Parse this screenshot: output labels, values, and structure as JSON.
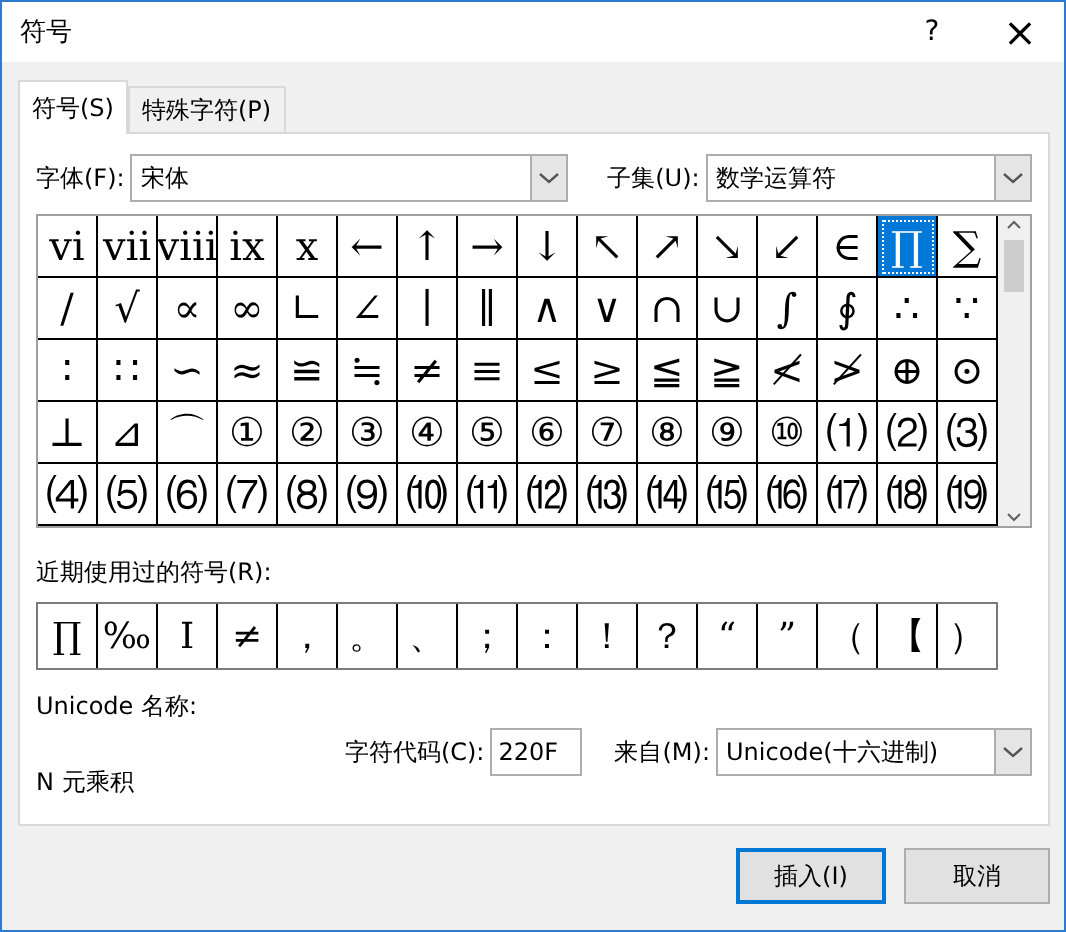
{
  "window": {
    "title": "符号",
    "help": "?",
    "close": "×"
  },
  "tabs": [
    {
      "label": "符号(S)",
      "selected": true
    },
    {
      "label": "特殊字符(P)",
      "selected": false
    }
  ],
  "font": {
    "label": "字体(F):",
    "value": "宋体"
  },
  "subset": {
    "label": "子集(U):",
    "value": "数学运算符"
  },
  "grid": [
    [
      {
        "c": "ⅵ",
        "selected": false
      },
      {
        "c": "ⅶ",
        "selected": false
      },
      {
        "c": "ⅷ",
        "selected": false
      },
      {
        "c": "ⅸ",
        "selected": false
      },
      {
        "c": "ⅹ",
        "selected": false
      },
      {
        "c": "←",
        "selected": false
      },
      {
        "c": "↑",
        "selected": false
      },
      {
        "c": "→",
        "selected": false
      },
      {
        "c": "↓",
        "selected": false
      },
      {
        "c": "↖",
        "selected": false
      },
      {
        "c": "↗",
        "selected": false
      },
      {
        "c": "↘",
        "selected": false
      },
      {
        "c": "↙",
        "selected": false
      },
      {
        "c": "∈",
        "selected": false
      },
      {
        "c": "∏",
        "selected": true
      },
      {
        "c": "∑",
        "selected": false
      }
    ],
    [
      {
        "c": "∕",
        "selected": false
      },
      {
        "c": "√",
        "selected": false
      },
      {
        "c": "∝",
        "selected": false
      },
      {
        "c": "∞",
        "selected": false
      },
      {
        "c": "∟",
        "selected": false
      },
      {
        "c": "∠",
        "selected": false
      },
      {
        "c": "∣",
        "selected": false
      },
      {
        "c": "∥",
        "selected": false
      },
      {
        "c": "∧",
        "selected": false
      },
      {
        "c": "∨",
        "selected": false
      },
      {
        "c": "∩",
        "selected": false
      },
      {
        "c": "∪",
        "selected": false
      },
      {
        "c": "∫",
        "selected": false
      },
      {
        "c": "∮",
        "selected": false
      },
      {
        "c": "∴",
        "selected": false
      },
      {
        "c": "∵",
        "selected": false
      }
    ],
    [
      {
        "c": "∶",
        "selected": false
      },
      {
        "c": "∷",
        "selected": false
      },
      {
        "c": "∽",
        "selected": false
      },
      {
        "c": "≈",
        "selected": false
      },
      {
        "c": "≌",
        "selected": false
      },
      {
        "c": "≒",
        "selected": false
      },
      {
        "c": "≠",
        "selected": false
      },
      {
        "c": "≡",
        "selected": false
      },
      {
        "c": "≤",
        "selected": false
      },
      {
        "c": "≥",
        "selected": false
      },
      {
        "c": "≦",
        "selected": false
      },
      {
        "c": "≧",
        "selected": false
      },
      {
        "c": "≮",
        "selected": false
      },
      {
        "c": "≯",
        "selected": false
      },
      {
        "c": "⊕",
        "selected": false
      },
      {
        "c": "⊙",
        "selected": false
      }
    ],
    [
      {
        "c": "⊥",
        "selected": false
      },
      {
        "c": "⊿",
        "selected": false
      },
      {
        "c": "⌒",
        "selected": false
      },
      {
        "c": "①",
        "selected": false
      },
      {
        "c": "②",
        "selected": false
      },
      {
        "c": "③",
        "selected": false
      },
      {
        "c": "④",
        "selected": false
      },
      {
        "c": "⑤",
        "selected": false
      },
      {
        "c": "⑥",
        "selected": false
      },
      {
        "c": "⑦",
        "selected": false
      },
      {
        "c": "⑧",
        "selected": false
      },
      {
        "c": "⑨",
        "selected": false
      },
      {
        "c": "⑩",
        "selected": false
      },
      {
        "c": "⑴",
        "selected": false
      },
      {
        "c": "⑵",
        "selected": false
      },
      {
        "c": "⑶",
        "selected": false
      }
    ],
    [
      {
        "c": "⑷",
        "selected": false
      },
      {
        "c": "⑸",
        "selected": false
      },
      {
        "c": "⑹",
        "selected": false
      },
      {
        "c": "⑺",
        "selected": false
      },
      {
        "c": "⑻",
        "selected": false
      },
      {
        "c": "⑼",
        "selected": false
      },
      {
        "c": "⑽",
        "selected": false
      },
      {
        "c": "⑾",
        "selected": false
      },
      {
        "c": "⑿",
        "selected": false
      },
      {
        "c": "⒀",
        "selected": false
      },
      {
        "c": "⒁",
        "selected": false
      },
      {
        "c": "⒂",
        "selected": false
      },
      {
        "c": "⒃",
        "selected": false
      },
      {
        "c": "⒄",
        "selected": false
      },
      {
        "c": "⒅",
        "selected": false
      },
      {
        "c": "⒆",
        "selected": false
      }
    ]
  ],
  "recent": {
    "label": "近期使用过的符号(R):",
    "symbols": [
      "∏",
      "‰",
      "Ⅰ",
      "≠",
      "，",
      "。",
      "、",
      "；",
      "：",
      "！",
      "？",
      "“",
      "”",
      "（",
      "【",
      "）"
    ]
  },
  "unicode_name": {
    "label": "Unicode 名称:",
    "value": "N 元乘积"
  },
  "char_code": {
    "label": "字符代码(C):",
    "value": "220F"
  },
  "from": {
    "label": "来自(M):",
    "value": "Unicode(十六进制)"
  },
  "buttons": [
    {
      "label": "插入(I)",
      "kind": "default"
    },
    {
      "label": "取消",
      "kind": "normal"
    }
  ]
}
